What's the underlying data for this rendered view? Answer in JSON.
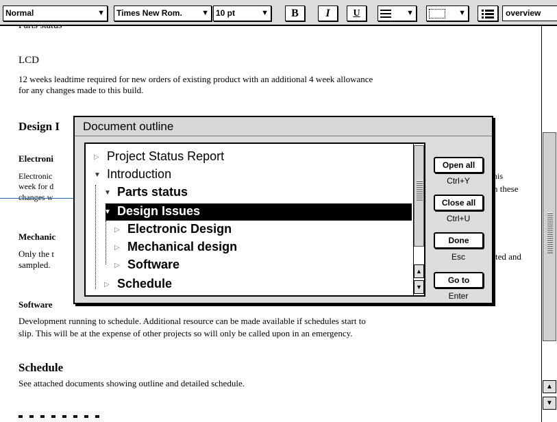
{
  "toolbar": {
    "style_value": "Normal",
    "font_value": "Times New Rom.",
    "size_value": "10 pt",
    "bold": "B",
    "italic": "I",
    "underline": "U",
    "view_value": "overview"
  },
  "document": {
    "partial_top": "Parts status",
    "lcd_heading": "LCD",
    "lcd_line1": "12 weeks leadtime required for new orders of existing product with an additional 4 week allowance",
    "lcd_line2": "for any changes made to this build.",
    "design_heading": "Design I",
    "electronic_heading": "Electroni",
    "electronic_line1": "Electronic",
    "electronic_line2": "week for d",
    "electronic_line3": "changes w",
    "electronic_right1": "his",
    "electronic_right2": "n these",
    "mechanical_heading": "Mechanic",
    "mechanical_line1": "Only the t",
    "mechanical_line2": "sampled.",
    "mechanical_right": "ted and",
    "software_heading": "Software",
    "software_line1": "Development running to schedule.  Additional resource can be made available if schedules start to",
    "software_line2": "slip.  This will be at the expense of other projects so will only be called upon in an emergency.",
    "schedule_heading": "Schedule",
    "schedule_line1": "See attached documents showing outline and detailed schedule."
  },
  "dialog": {
    "title": "Document outline",
    "outline": [
      {
        "label": "Project Status Report",
        "expanded": false
      },
      {
        "label": "Introduction",
        "expanded": true
      },
      {
        "label": "Parts status",
        "expanded": true
      },
      {
        "label": "Design Issues",
        "expanded": true,
        "selected": true
      },
      {
        "label": "Electronic Design",
        "expanded": false
      },
      {
        "label": "Mechanical design",
        "expanded": false
      },
      {
        "label": "Software",
        "expanded": false
      },
      {
        "label": "Schedule",
        "expanded": false
      }
    ],
    "buttons": {
      "open_all": "Open all",
      "open_all_shortcut": "Ctrl+Y",
      "close_all": "Close all",
      "close_all_shortcut": "Ctrl+U",
      "done": "Done",
      "done_shortcut": "Esc",
      "goto": "Go to",
      "goto_shortcut": "Enter"
    }
  },
  "icons": {
    "expanded": "triangle-down-icon",
    "collapsed": "triangle-right-icon",
    "scroll_up": "arrow-up-icon",
    "scroll_down": "arrow-down-icon",
    "dropdown": "chevron-down-icon"
  },
  "colors": {
    "selection": "#000000",
    "toolbar_bg": "#dcdcdc",
    "dialog_bg": "#dcdcdc"
  }
}
